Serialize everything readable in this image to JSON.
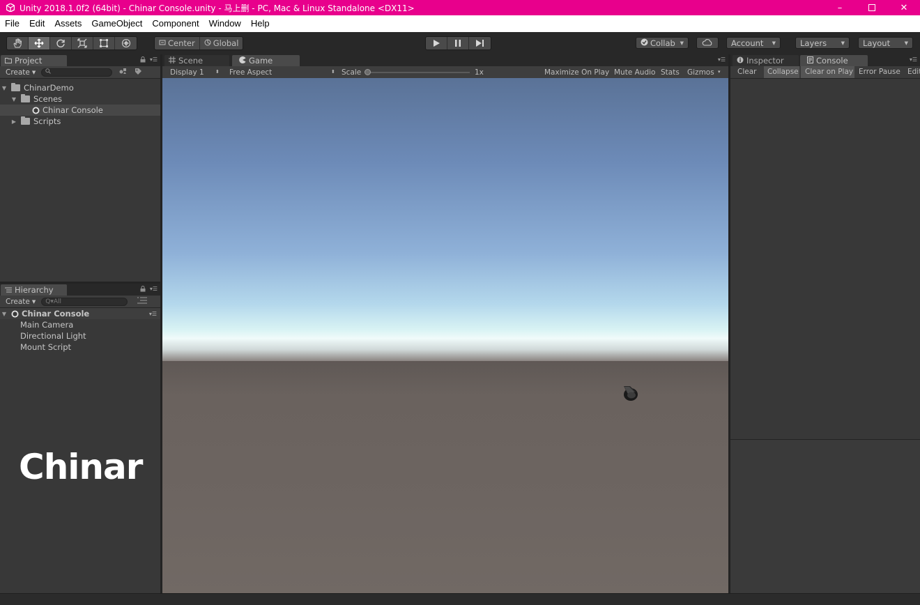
{
  "window": {
    "title": "Unity 2018.1.0f2 (64bit) - Chinar Console.unity - 马上删 - PC, Mac & Linux Standalone <DX11>",
    "controls": [
      "minimize-icon",
      "maximize-icon",
      "close-icon"
    ]
  },
  "menu": [
    "File",
    "Edit",
    "Assets",
    "GameObject",
    "Component",
    "Window",
    "Help"
  ],
  "toolbar": {
    "transform_tools": [
      "hand-icon",
      "move-icon",
      "rotate-icon",
      "scale-icon",
      "rect-icon",
      "transform-icon"
    ],
    "active_tool": "move-icon",
    "pivot": {
      "center": "Center",
      "global": "Global"
    },
    "play_controls": [
      "play-icon",
      "pause-icon",
      "step-icon"
    ],
    "collab": "Collab",
    "account": "Account",
    "layers": "Layers",
    "layout": "Layout"
  },
  "project_panel": {
    "tab": "Project",
    "create": "Create",
    "tree": [
      {
        "label": "ChinarDemo",
        "level": 0,
        "type": "folder",
        "expanded": true
      },
      {
        "label": "Scenes",
        "level": 1,
        "type": "folder",
        "expanded": true
      },
      {
        "label": "Chinar Console",
        "level": 2,
        "type": "scene",
        "selected": true
      },
      {
        "label": "Scripts",
        "level": 1,
        "type": "folder",
        "expanded": false
      }
    ]
  },
  "hierarchy_panel": {
    "tab": "Hierarchy",
    "create": "Create",
    "search_placeholder": "Q▾All",
    "scene": "Chinar Console",
    "items": [
      "Main Camera",
      "Directional Light",
      "Mount Script"
    ]
  },
  "watermark": "Chinar",
  "view_tabs": {
    "scene": "Scene",
    "game": "Game"
  },
  "game_bar": {
    "display": "Display 1",
    "aspect": "Free Aspect",
    "scale_label": "Scale",
    "scale_value": "1x",
    "maximize": "Maximize On Play",
    "mute": "Mute Audio",
    "stats": "Stats",
    "gizmos": "Gizmos"
  },
  "right_tabs": {
    "inspector": "Inspector",
    "console": "Console"
  },
  "console_bar": {
    "clear": "Clear",
    "collapse": "Collapse",
    "clear_on_play": "Clear on Play",
    "error_pause": "Error Pause",
    "editor": "Edit"
  }
}
